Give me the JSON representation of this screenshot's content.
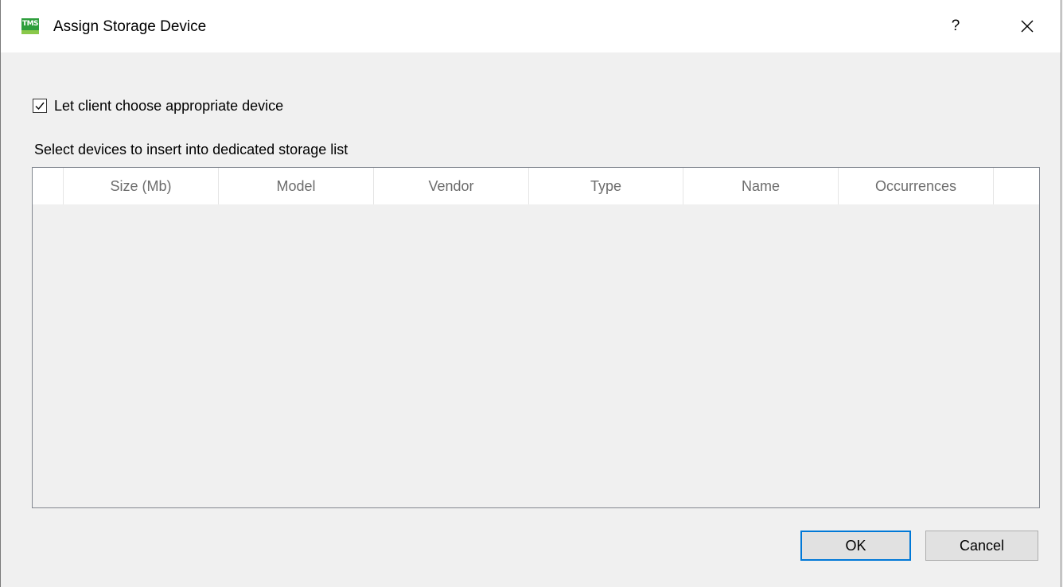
{
  "window": {
    "title": "Assign Storage Device",
    "app_icon_text": "TMS",
    "help_label": "?"
  },
  "options": {
    "auto_choose_label": "Let client choose appropriate device",
    "auto_choose_checked": true
  },
  "devices": {
    "section_label": "Select devices to insert into dedicated storage list",
    "columns": [
      "",
      "Size (Mb)",
      "Model",
      "Vendor",
      "Type",
      "Name",
      "Occurrences",
      ""
    ],
    "rows": []
  },
  "buttons": {
    "ok_label": "OK",
    "cancel_label": "Cancel"
  },
  "colors": {
    "accent": "#0078d7",
    "icon_green": "#2e9e3c"
  },
  "icons": {
    "app": "tms-app-icon",
    "close": "close-icon",
    "check": "checkmark-icon"
  }
}
